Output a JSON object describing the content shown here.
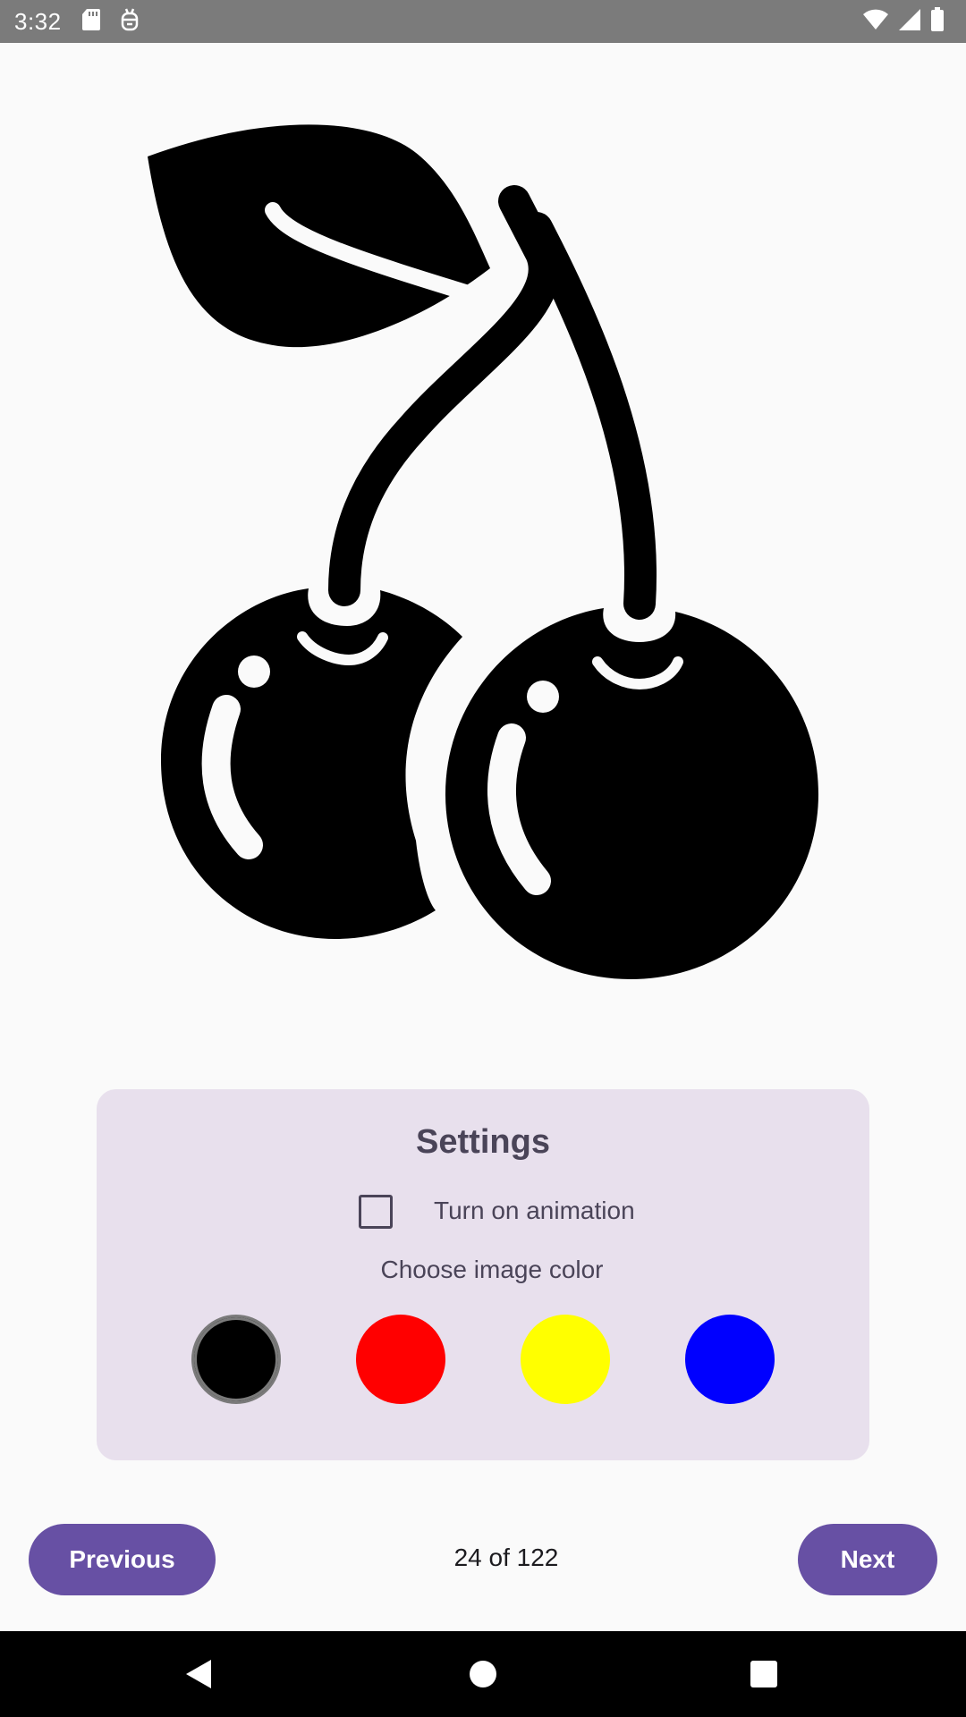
{
  "status_bar": {
    "time": "3:32",
    "left_icons": [
      "sd-card-icon",
      "debug-icon"
    ],
    "right_icons": [
      "wifi-icon",
      "signal-icon",
      "battery-icon"
    ]
  },
  "hero": {
    "image": "cherry-icon",
    "color": "#000000"
  },
  "settings": {
    "title": "Settings",
    "animation_label": "Turn on animation",
    "animation_checked": false,
    "color_label": "Choose image color",
    "colors": [
      {
        "name": "black",
        "hex": "#000000",
        "selected": true
      },
      {
        "name": "red",
        "hex": "#ff0000",
        "selected": false
      },
      {
        "name": "yellow",
        "hex": "#ffff00",
        "selected": false
      },
      {
        "name": "blue",
        "hex": "#0000ff",
        "selected": false
      }
    ]
  },
  "navigation": {
    "previous_label": "Previous",
    "next_label": "Next",
    "page_counter": "24 of 122"
  },
  "system_nav": {
    "buttons": [
      "back-icon",
      "home-icon",
      "recents-icon"
    ]
  },
  "theme": {
    "accent": "#6750a4",
    "card_bg": "#e8e0ed"
  }
}
